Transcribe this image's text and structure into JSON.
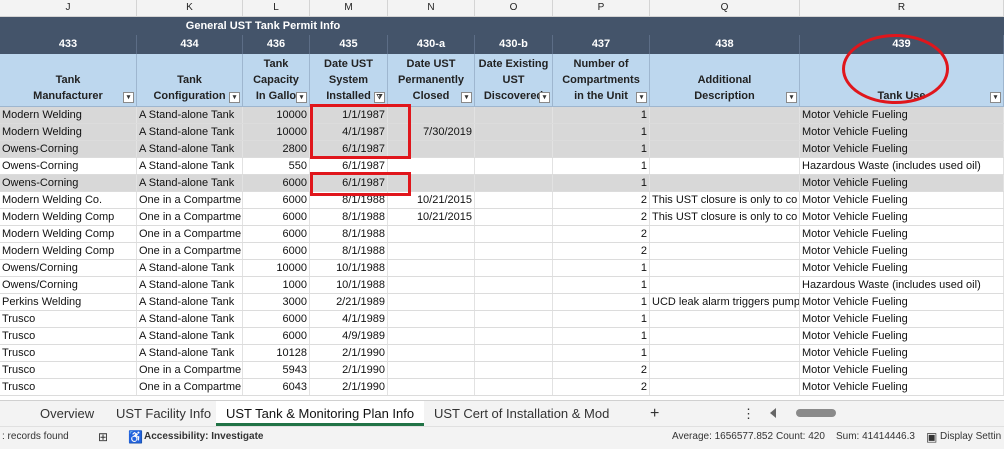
{
  "columns": {
    "letters": [
      "J",
      "K",
      "L",
      "M",
      "N",
      "O",
      "P",
      "Q",
      "R"
    ],
    "codes": [
      "433",
      "434",
      "436",
      "435",
      "430-a",
      "430-b",
      "437",
      "438",
      "439"
    ],
    "headers": [
      "Tank\nManufacturer",
      "Tank\nConfiguration",
      "Tank\nCapacity\nIn Gallo",
      "Date UST\nSystem\nInstalled",
      "Date UST\nPermanently\nClosed",
      "Date Existing\nUST\nDiscovered",
      "Number of\nCompartments\nin the Unit",
      "Additional\nDescription",
      "Tank Use"
    ]
  },
  "group_title": "General UST Tank Permit Info",
  "rows": [
    {
      "shaded": true,
      "cells": [
        "Modern Welding",
        "A Stand-alone Tank",
        "10000",
        "1/1/1987",
        "",
        "",
        "1",
        "",
        "Motor Vehicle Fueling"
      ]
    },
    {
      "shaded": true,
      "cells": [
        "Modern Welding",
        "A Stand-alone Tank",
        "10000",
        "4/1/1987",
        "7/30/2019",
        "",
        "1",
        "",
        "Motor Vehicle Fueling"
      ]
    },
    {
      "shaded": true,
      "cells": [
        "Owens-Corning",
        "A Stand-alone Tank",
        "2800",
        "6/1/1987",
        "",
        "",
        "1",
        "",
        "Motor Vehicle Fueling"
      ]
    },
    {
      "shaded": false,
      "cells": [
        "Owens-Corning",
        "A Stand-alone Tank",
        "550",
        "6/1/1987",
        "",
        "",
        "1",
        "",
        "Hazardous Waste (includes used oil)"
      ]
    },
    {
      "shaded": true,
      "cells": [
        "Owens-Corning",
        "A Stand-alone Tank",
        "6000",
        "6/1/1987",
        "",
        "",
        "1",
        "",
        "Motor Vehicle Fueling"
      ]
    },
    {
      "shaded": false,
      "cells": [
        "Modern Welding Co.",
        "One in a Compartme",
        "6000",
        "8/1/1988",
        "10/21/2015",
        "",
        "2",
        "This UST closure is only to co",
        "Motor Vehicle Fueling"
      ]
    },
    {
      "shaded": false,
      "cells": [
        "Modern Welding Comp",
        "One in a Compartme",
        "6000",
        "8/1/1988",
        "10/21/2015",
        "",
        "2",
        "This UST closure is only to co",
        "Motor Vehicle Fueling"
      ]
    },
    {
      "shaded": false,
      "cells": [
        "Modern Welding Comp",
        "One in a Compartme",
        "6000",
        "8/1/1988",
        "",
        "",
        "2",
        "",
        "Motor Vehicle Fueling"
      ]
    },
    {
      "shaded": false,
      "cells": [
        "Modern Welding Comp",
        "One in a Compartme",
        "6000",
        "8/1/1988",
        "",
        "",
        "2",
        "",
        "Motor Vehicle Fueling"
      ]
    },
    {
      "shaded": false,
      "cells": [
        "Owens/Corning",
        "A Stand-alone Tank",
        "10000",
        "10/1/1988",
        "",
        "",
        "1",
        "",
        "Motor Vehicle Fueling"
      ]
    },
    {
      "shaded": false,
      "cells": [
        "Owens/Corning",
        "A Stand-alone Tank",
        "1000",
        "10/1/1988",
        "",
        "",
        "1",
        "",
        "Hazardous Waste (includes used oil)"
      ]
    },
    {
      "shaded": false,
      "cells": [
        "Perkins Welding",
        "A Stand-alone Tank",
        "3000",
        "2/21/1989",
        "",
        "",
        "1",
        "UCD leak alarm triggers pump",
        "Motor Vehicle Fueling"
      ]
    },
    {
      "shaded": false,
      "cells": [
        "Trusco",
        "A Stand-alone Tank",
        "6000",
        "4/1/1989",
        "",
        "",
        "1",
        "",
        "Motor Vehicle Fueling"
      ]
    },
    {
      "shaded": false,
      "cells": [
        "Trusco",
        "A Stand-alone Tank",
        "6000",
        "4/9/1989",
        "",
        "",
        "1",
        "",
        "Motor Vehicle Fueling"
      ]
    },
    {
      "shaded": false,
      "cells": [
        "Trusco",
        "A Stand-alone Tank",
        "10128",
        "2/1/1990",
        "",
        "",
        "1",
        "",
        "Motor Vehicle Fueling"
      ]
    },
    {
      "shaded": false,
      "cells": [
        "Trusco",
        "One in a Compartme",
        "5943",
        "2/1/1990",
        "",
        "",
        "2",
        "",
        "Motor Vehicle Fueling"
      ]
    },
    {
      "shaded": false,
      "cells": [
        "Trusco",
        "One in a Compartme",
        "6043",
        "2/1/1990",
        "",
        "",
        "2",
        "",
        "Motor Vehicle Fueling"
      ]
    }
  ],
  "tabs": [
    "Overview",
    "UST Facility Info",
    "UST Tank & Monitoring Plan Info",
    "UST Cert of Installation & Mod"
  ],
  "tab_add": "+",
  "tab_more": "⋮",
  "status": {
    "records": ": records found",
    "accessibility": "Accessibility: Investigate",
    "average": "Average: 1656577.852",
    "count": "Count: 420",
    "sum": "Sum: 41414446.3",
    "display": "Display Settin"
  },
  "colors": {
    "header_dark": "#44546a",
    "header_light": "#bdd7ee",
    "highlight": "#e0161c",
    "active_tab": "#217346"
  }
}
